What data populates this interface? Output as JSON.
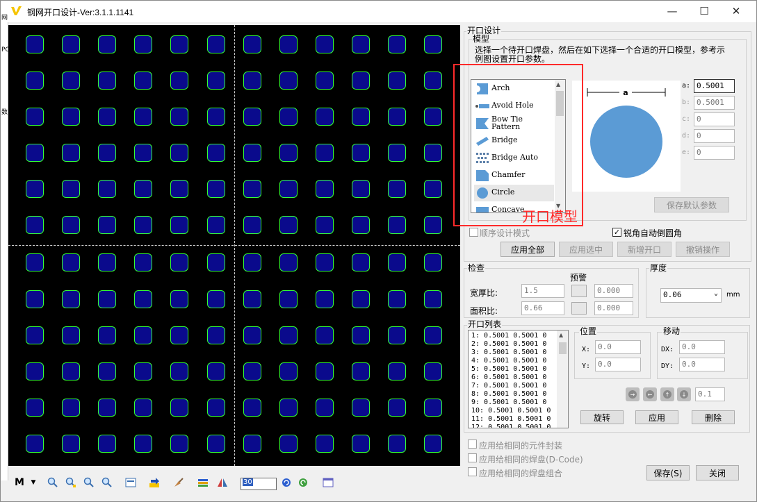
{
  "window": {
    "title": "钢网开口设计-Ver:3.1.1.1141",
    "minimize": "—",
    "maximize": "☐",
    "close": "✕"
  },
  "left_strip": [
    "网",
    "PC",
    "数"
  ],
  "toolbar": {
    "m_label": "M",
    "zoom_value": "30"
  },
  "design": {
    "group_label": "开口设计",
    "model_group_label": "模型",
    "instruction": "选择一个待开口焊盘，然后在如下选择一个合适的开口模型，参考示例图设置开口参数。",
    "models": [
      {
        "label": "Arch",
        "icon": "arch-icon"
      },
      {
        "label": "Avoid Hole",
        "icon": "avoid-hole-icon"
      },
      {
        "label": "Bow Tie\nPattern",
        "icon": "bow-tie-icon"
      },
      {
        "label": "Bridge",
        "icon": "bridge-icon"
      },
      {
        "label": "Bridge Auto",
        "icon": "bridge-auto-icon"
      },
      {
        "label": "Chamfer",
        "icon": "chamfer-icon"
      },
      {
        "label": "Circle",
        "icon": "circle-icon"
      },
      {
        "label": "Concave",
        "icon": "concave-icon"
      }
    ],
    "selected_model": "Circle",
    "annotation": "开口模型",
    "preview_dim_label": "a",
    "params": [
      {
        "label": "a:",
        "value": "0.5001",
        "active": true
      },
      {
        "label": "b:",
        "value": "0.5001",
        "active": false
      },
      {
        "label": "c:",
        "value": "0",
        "active": false
      },
      {
        "label": "d:",
        "value": "0",
        "active": false
      },
      {
        "label": "e:",
        "value": "0",
        "active": false
      }
    ],
    "save_default": "保存默认参数",
    "sequential_mode": "顺序设计模式",
    "sequential_checked": false,
    "auto_round": "锐角自动倒圆角",
    "auto_round_checked": true,
    "apply_all": "应用全部",
    "apply_selected": "应用选中",
    "add_opening": "新增开口",
    "undo": "撤销操作"
  },
  "check": {
    "label": "检查",
    "warning_label": "预警",
    "ratio_label": "宽厚比:",
    "ratio_value": "1.5",
    "ratio_warn": "0.000",
    "area_label": "面积比:",
    "area_value": "0.66",
    "area_warn": "0.000"
  },
  "thickness": {
    "label": "厚度",
    "value": "0.06",
    "unit": "mm"
  },
  "opening_list": {
    "label": "开口列表",
    "rows": [
      "1: 0.5001 0.5001 0",
      "2: 0.5001 0.5001 0",
      "3: 0.5001 0.5001 0",
      "4: 0.5001 0.5001 0",
      "5: 0.5001 0.5001 0",
      "6: 0.5001 0.5001 0",
      "7: 0.5001 0.5001 0",
      "8: 0.5001 0.5001 0",
      "9: 0.5001 0.5001 0",
      "10: 0.5001 0.5001 0",
      "11: 0.5001 0.5001 0",
      "12: 0.5001 0.5001 0"
    ]
  },
  "position": {
    "label": "位置",
    "x_label": "X:",
    "x_value": "0.0",
    "y_label": "Y:",
    "y_value": "0.0"
  },
  "move": {
    "label": "移动",
    "dx_label": "DX:",
    "dx_value": "0.0",
    "dy_label": "DY:",
    "dy_value": "0.0",
    "step": "0.1"
  },
  "actions": {
    "rotate": "旋转",
    "apply": "应用",
    "delete": "删除"
  },
  "apply_options": [
    "应用给相同的元件封装",
    "应用给相同的焊盘(D-Code)",
    "应用给相同的焊盘组合"
  ],
  "footer": {
    "save": "保存(S)",
    "close": "关闭"
  },
  "colors": {
    "pad_fill": "#0a0a8c",
    "pad_outline": "#35ff35",
    "canvas": "#000000",
    "annotation": "#ff2a2a",
    "preview_circle": "#5b9bd5"
  }
}
